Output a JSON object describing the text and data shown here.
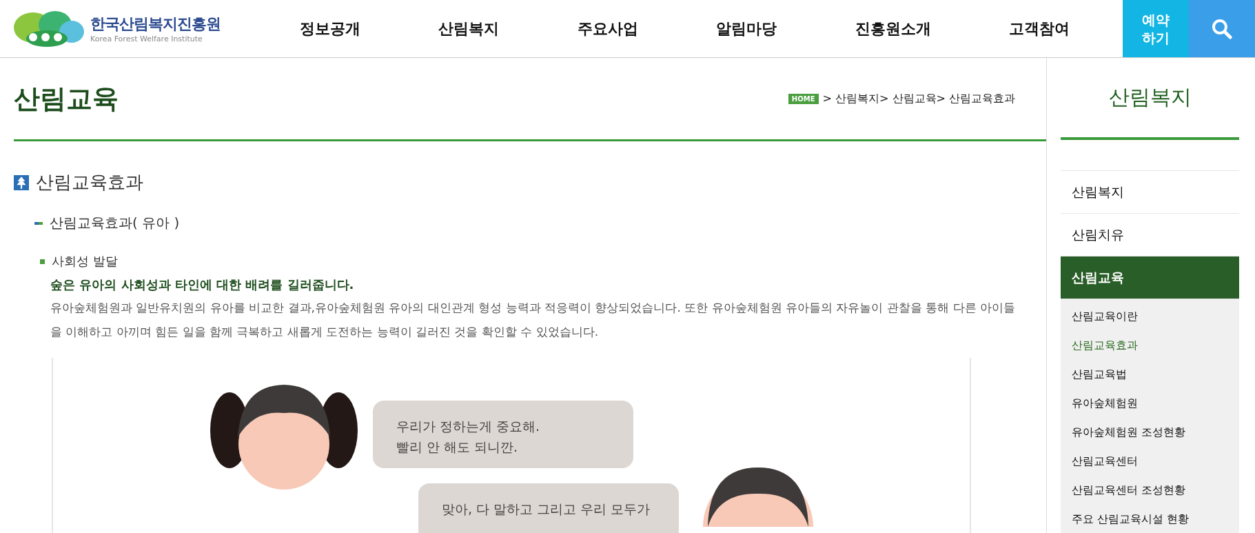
{
  "header": {
    "logo": {
      "name": "한국산림복지진흥원",
      "subtitle": "Korea Forest Welfare Institute"
    },
    "nav": [
      {
        "label": "정보공개"
      },
      {
        "label": "산림복지"
      },
      {
        "label": "주요사업"
      },
      {
        "label": "알림마당"
      },
      {
        "label": "진흥원소개"
      },
      {
        "label": "고객참여"
      }
    ],
    "booking_button": "예약\n하기"
  },
  "page": {
    "title": "산림교육",
    "breadcrumb": {
      "home": "HOME",
      "trail": "> 산림복지> 산림교육> 산림교육효과"
    },
    "section_title": "산림교육효과",
    "subsection_title": "산림교육효과( 유아 )",
    "topic": "사회성 발달",
    "lead": "숲은 유아의 사회성과 타인에 대한 배려를 길러줍니다.",
    "paragraph": "유아숲체험원과 일반유치원의 유아를 비교한 결과,유아숲체험원 유아의 대인관계 형성 능력과 적응력이 향상되었습니다. 또한 유아숲체험원 유아들의 자유놀이 관찰을 통해 다른 아이들을 이해하고 아끼며 힘든 일을 함께 극복하고 새롭게 도전하는 능력이 길러진 것을 확인할 수 있었습니다.",
    "illustration": {
      "bubbles": [
        "우리가 정하는게 중요해.\n빨리 안 해도 되니깐.",
        "맞아, 다 말하고 그리고 우리 모두가"
      ]
    }
  },
  "sidebar": {
    "title": "산림복지",
    "items": [
      {
        "label": "산림복지",
        "selected": false
      },
      {
        "label": "산림치유",
        "selected": false
      },
      {
        "label": "산림교육",
        "selected": true,
        "children": [
          {
            "label": "산림교육이란",
            "selected": false
          },
          {
            "label": "산림교육효과",
            "selected": true
          },
          {
            "label": "산림교육법",
            "selected": false
          },
          {
            "label": "유아숲체험원",
            "selected": false
          },
          {
            "label": "유아숲체험원 조성현황",
            "selected": false
          },
          {
            "label": "산림교육센터",
            "selected": false
          },
          {
            "label": "산림교육센터 조성현황",
            "selected": false
          },
          {
            "label": "주요 산림교육시설 현황",
            "selected": false
          }
        ]
      }
    ]
  }
}
